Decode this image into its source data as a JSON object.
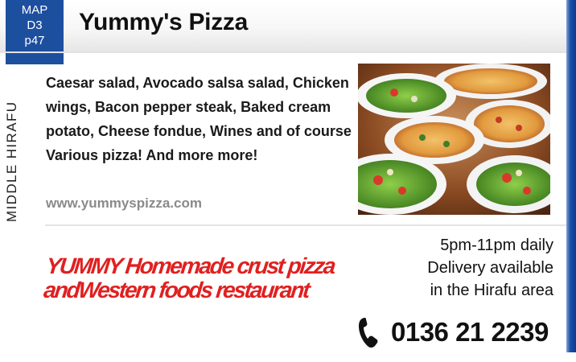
{
  "map_badge": {
    "line1": "MAP",
    "line2": "D3",
    "line3": "p47",
    "color": "#1d4f9f"
  },
  "title": "Yummy's Pizza",
  "area": "MIDDLE HIRAFU",
  "description": "Caesar salad, Avocado salsa salad, Chicken wings, Bacon pepper steak, Baked cream potato, Cheese fondue, Wines and of course Various pizza! And more more!",
  "website": "www.yummyspizza.com",
  "photo": {
    "icon": "food-photo"
  },
  "tagline": {
    "line1": "YUMMY Homemade crust pizza",
    "line2": "andWestern foods restaurant",
    "color": "#e02020"
  },
  "hours": {
    "line1": "5pm-11pm daily",
    "line2": "Delivery available",
    "line3": "in the Hirafu area"
  },
  "phone": {
    "icon": "phone-icon",
    "number": "0136  21  2239"
  }
}
